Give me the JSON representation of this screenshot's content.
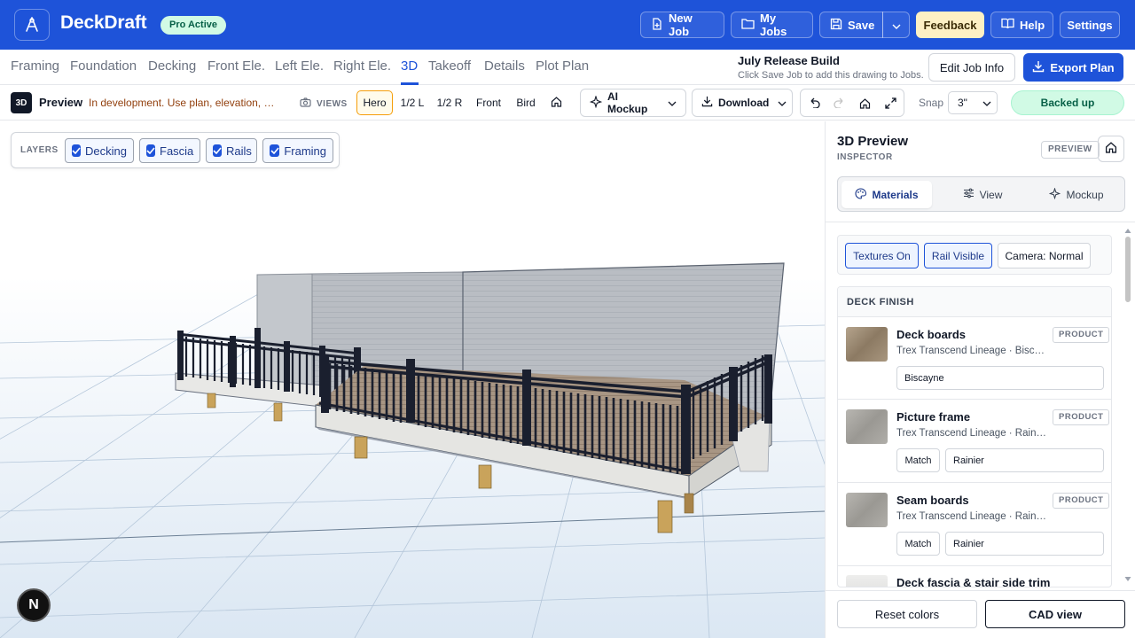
{
  "app": {
    "name": "DeckDraft",
    "badge": "Pro Active"
  },
  "topbar": {
    "new_job": "New Job",
    "my_jobs": "My Jobs",
    "save": "Save",
    "feedback": "Feedback",
    "help": "Help",
    "settings": "Settings"
  },
  "nav": {
    "tabs": [
      "Framing",
      "Foundation",
      "Decking",
      "Front Ele.",
      "Left Ele.",
      "Right Ele.",
      "3D",
      "Takeoff",
      "Details",
      "Plot Plan"
    ],
    "active": "3D"
  },
  "release": {
    "title": "July Release Build",
    "subtitle": "Click Save Job to add this drawing to Jobs."
  },
  "actions": {
    "edit_job_info": "Edit Job Info",
    "export_plan": "Export Plan"
  },
  "toolbar": {
    "tag": "3D",
    "preview": "Preview",
    "dev_note": "In development. Use plan, elevation, and takeoff views for final output.",
    "views_label": "VIEWS",
    "views": [
      "Hero",
      "1/2 L",
      "1/2 R",
      "Front",
      "Bird"
    ],
    "active_view": "Hero",
    "ai_mockup": "AI Mockup",
    "download": "Download",
    "snap_label": "Snap",
    "snap_value": "3\"",
    "status": "Backed up"
  },
  "layers": {
    "label": "LAYERS",
    "items": [
      {
        "label": "Decking",
        "checked": true
      },
      {
        "label": "Fascia",
        "checked": true
      },
      {
        "label": "Rails",
        "checked": true
      },
      {
        "label": "Framing",
        "checked": true
      }
    ]
  },
  "avatar_initial": "N",
  "inspector": {
    "title": "3D Preview",
    "subtitle": "INSPECTOR",
    "badge": "PREVIEW",
    "tabs": [
      "Materials",
      "View",
      "Mockup"
    ],
    "active_tab": "Materials",
    "chips": [
      {
        "label": "Textures On",
        "on": true
      },
      {
        "label": "Rail Visible",
        "on": true
      },
      {
        "label": "Camera: Normal",
        "on": false
      }
    ],
    "finish_title": "DECK FINISH",
    "materials": [
      {
        "name": "Deck boards",
        "product": "Trex Transcend Lineage · Biscayne",
        "badge": "PRODUCT",
        "value": "Biscayne",
        "match": null
      },
      {
        "name": "Picture frame",
        "product": "Trex Transcend Lineage · Rainier",
        "badge": "PRODUCT",
        "value": "Rainier",
        "match": "Match"
      },
      {
        "name": "Seam boards",
        "product": "Trex Transcend Lineage · Rainier",
        "badge": "PRODUCT",
        "value": "Rainier",
        "match": "Match"
      },
      {
        "name": "Deck fascia & stair side trim",
        "product": "",
        "badge": "",
        "value": "",
        "match": null
      }
    ],
    "reset_colors": "Reset colors",
    "cad_view": "CAD view"
  },
  "colors": {
    "brand_blue": "#1e53d9",
    "badge_green": "#d1fae5",
    "feedback_yellow": "#fdf0c4",
    "rail_black": "#1a1f2e",
    "siding_gray": "#b9bdc3"
  }
}
